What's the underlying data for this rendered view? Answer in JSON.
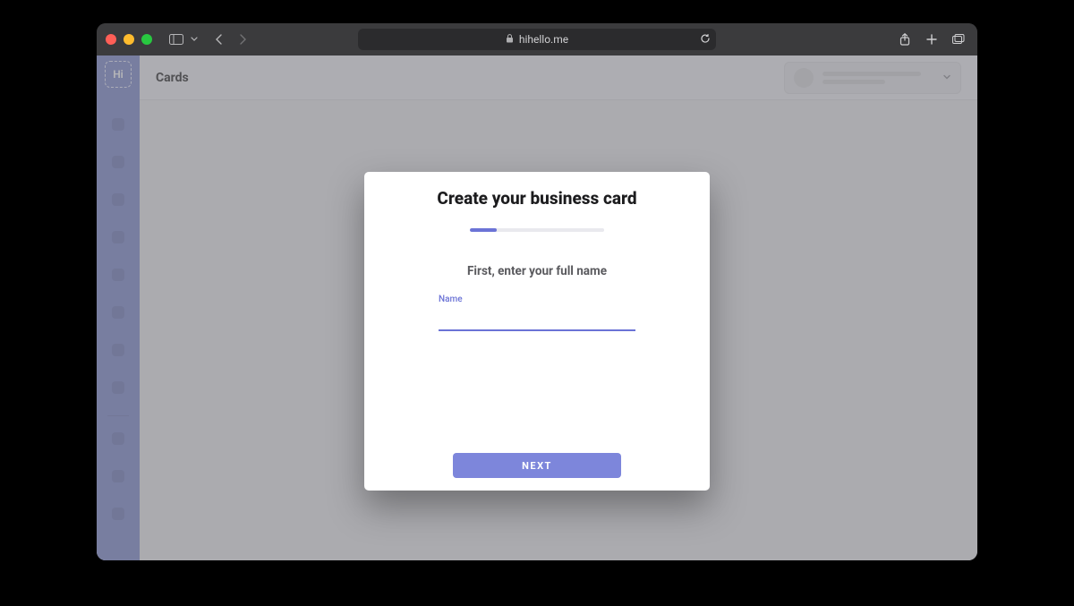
{
  "browser": {
    "url": "hihello.me",
    "lock_icon": "lock-icon",
    "reload_icon": "reload-icon",
    "share_icon": "share-icon",
    "newtab_icon": "plus-icon",
    "tabs_icon": "tab-overview-icon",
    "sidebar_icon": "sidebar-icon",
    "back_icon": "chevron-left-icon",
    "forward_icon": "chevron-right-icon"
  },
  "app": {
    "logo_text": "Hi",
    "header_title": "Cards",
    "account_chevron": "chevron-down-icon"
  },
  "modal": {
    "title": "Create your business card",
    "subtitle": "First, enter your full name",
    "field_label": "Name",
    "field_value": "",
    "next_label": "NEXT",
    "progress_percent": 20
  },
  "colors": {
    "accent": "#6b73d6",
    "rail": "#7885c9"
  }
}
